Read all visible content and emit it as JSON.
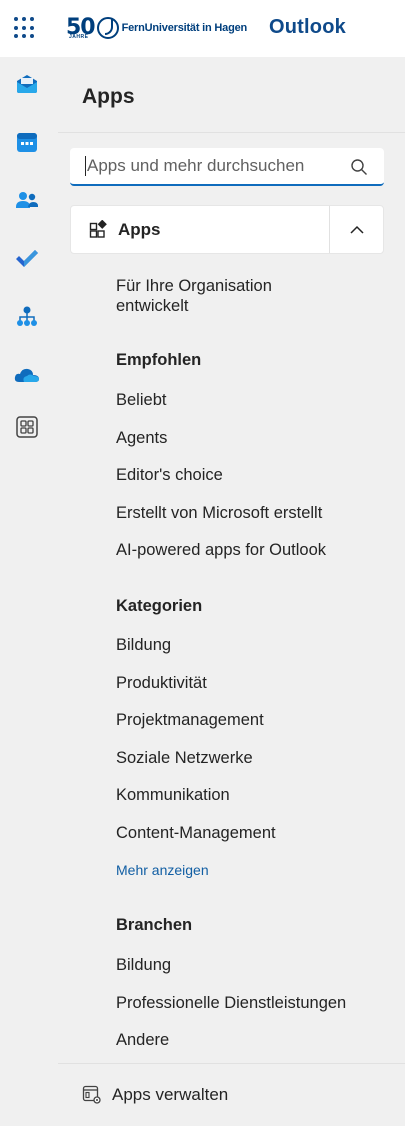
{
  "header": {
    "logo_number": "50",
    "logo_jahre": "JAHRE",
    "logo_text": "FernUniversität in Hagen",
    "app_name": "Outlook",
    "icon": "waffle-icon"
  },
  "rail": {
    "items": [
      {
        "icon": "mail-icon"
      },
      {
        "icon": "calendar-icon"
      },
      {
        "icon": "people-icon"
      },
      {
        "icon": "todo-icon"
      },
      {
        "icon": "org-explorer-icon"
      },
      {
        "icon": "onedrive-icon"
      },
      {
        "icon": "more-apps-icon"
      }
    ]
  },
  "panel": {
    "title": "Apps",
    "search_placeholder": "Apps und mehr durchsuchen",
    "apps_section": {
      "label": "Apps",
      "icon": "apps-add-icon",
      "collapse_icon": "chevron-up-icon"
    },
    "org_item": [
      "Für Ihre Organisation",
      "entwickelt"
    ],
    "recommended": {
      "heading": "Empfohlen",
      "items": [
        "Beliebt",
        "Agents",
        "Editor's choice",
        "Erstellt von Microsoft erstellt",
        "AI-powered apps for Outlook"
      ]
    },
    "categories": {
      "heading": "Kategorien",
      "items": [
        "Bildung",
        "Produktivität",
        "Projektmanagement",
        "Soziale Netzwerke",
        "Kommunikation",
        "Content-Management"
      ],
      "more_label": "Mehr anzeigen"
    },
    "industries": {
      "heading": "Branchen",
      "items": [
        "Bildung",
        "Professionelle Dienstleistungen",
        "Andere"
      ]
    },
    "manage": {
      "label": "Apps verwalten",
      "icon": "manage-apps-icon"
    }
  },
  "colors": {
    "brand_blue": "#0f4a8a",
    "link_blue": "#115ea3",
    "accent": "#0f6cbd"
  }
}
